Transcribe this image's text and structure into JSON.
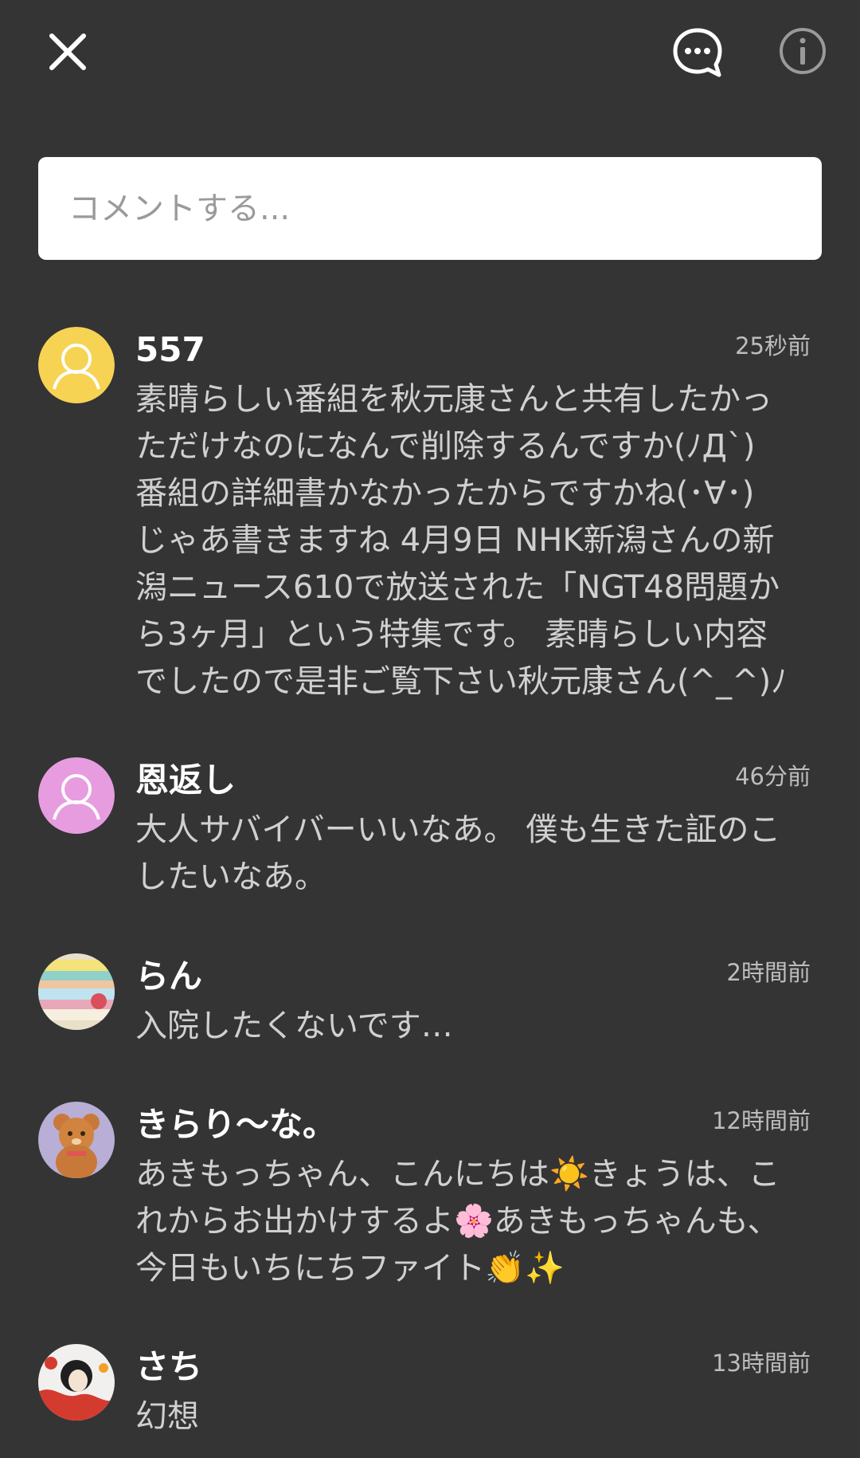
{
  "header": {
    "close_icon": "close-icon",
    "chat_icon": "chat-bubble-ellipsis-icon",
    "info_icon": "info-icon"
  },
  "comment_box": {
    "placeholder": "コメントする..."
  },
  "comments": [
    {
      "name": "557",
      "time": "25秒前",
      "avatar": "default-avatar-yellow",
      "lines": [
        "素晴らしい番組を秋元康さんと共有したかっ",
        "ただけなのになんで削除するんですか(ﾉДˋ)",
        "番組の詳細書かなかったからですかね(･∀･)",
        "じゃあ書きますね 4月9日 NHK新潟さんの新",
        "潟ニュース610で放送された「NGT48問題か",
        "ら3ヶ月」という特集です。 素晴らしい内容",
        "でしたので是非ご覧下さい秋元康さん(^_^)ﾉ"
      ]
    },
    {
      "name": "恩返し",
      "time": "46分前",
      "avatar": "default-avatar-pink",
      "lines": [
        "大人サバイバーいいなあ。 僕も生きた証のこ",
        "したいなあ。"
      ]
    },
    {
      "name": "らん",
      "time": "2時間前",
      "avatar": "pastel-stripes-photo",
      "lines": [
        "入院したくないです…"
      ]
    },
    {
      "name": "きらり〜な。",
      "time": "12時間前",
      "avatar": "teddy-bear-cookie-photo",
      "lines": [
        "あきもっちゃん、こんにちは☀️きょうは、こ",
        "れからお出かけするよ🌸あきもっちゃんも、",
        "今日もいちにちファイト👏✨"
      ]
    },
    {
      "name": "さち",
      "time": "13時間前",
      "avatar": "illustration-girl-photo",
      "lines": [
        "幻想"
      ]
    }
  ],
  "colors": {
    "background": "#343434",
    "input_background": "#ffffff",
    "name_text": "#ffffff",
    "body_text": "#d0d0d0",
    "time_text": "#bdbdbd",
    "avatar_yellow": "#f7d354",
    "avatar_pink": "#e79ce0"
  }
}
